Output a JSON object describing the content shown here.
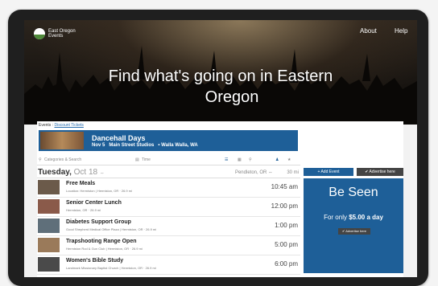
{
  "header": {
    "logo_line1": "East Oregon",
    "logo_line2": "Events",
    "nav": [
      "About",
      "Help"
    ],
    "title_line1": "Find what's going on in Eastern",
    "title_line2": "Oregon"
  },
  "breadcrumb": {
    "section": "Events",
    "separator": " : ",
    "link": "Discount Tickets"
  },
  "featured": {
    "name": "Dancehall Days",
    "date": "Nov 5",
    "venue": "Main Street Studios",
    "sep": "•",
    "city": "Walla Walla, WA"
  },
  "filters": {
    "search_placeholder": "Categories & Search",
    "time_label": "Time"
  },
  "day": {
    "weekday": "Tuesday,",
    "date": "Oct 18",
    "arrow": "⇔",
    "location": "Pendleton, OR ⇔",
    "radius": "30 mi"
  },
  "events": [
    {
      "title": "Free Meals",
      "sub": "Location: Hermiston | Hermiston, OR · 26.9 mi",
      "time": "10:45 am",
      "color": "#6b5a4a"
    },
    {
      "title": "Senior Center Lunch",
      "sub": "Hermiston, OR · 26.9 mi",
      "time": "12:00 pm",
      "color": "#8a5a4a"
    },
    {
      "title": "Diabetes Support Group",
      "sub": "Good Shepherd Medical Office Plaza | Hermiston, OR · 26.9 mi",
      "time": "1:00 pm",
      "color": "#5f6f7a"
    },
    {
      "title": "Trapshooting Range Open",
      "sub": "Hermiston Rod & Gun Club | Hermiston, OR · 26.9 mi",
      "time": "5:00 pm",
      "color": "#9a7a5a"
    },
    {
      "title": "Women's Bible Study",
      "sub": "Landmark Missionary Baptist Church | Hermiston, OR · 26.9 mi",
      "time": "6:00 pm",
      "color": "#4a4a4a"
    }
  ],
  "sidebar": {
    "add_event": "+ Add Event",
    "advertise": "✔ Advertise here",
    "ad_title": "Be Seen",
    "ad_prefix": "For only ",
    "ad_price": "$5.00 a day",
    "ad_button": "✔ Advertise here"
  },
  "colors": {
    "accent": "#1e5f98",
    "dark": "#444444"
  }
}
